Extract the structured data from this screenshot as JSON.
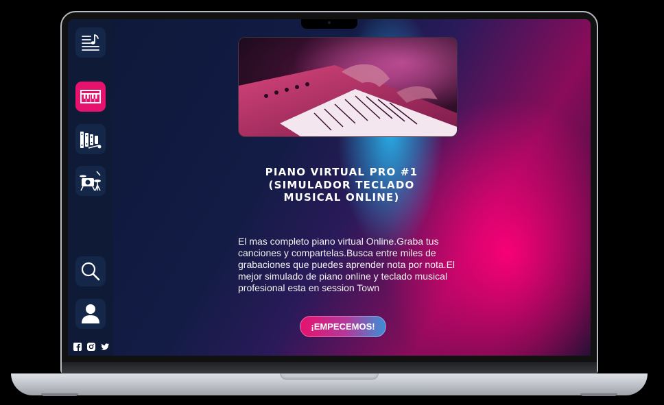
{
  "sidebar": {
    "items": [
      {
        "name": "sheet-music-icon"
      },
      {
        "name": "piano-icon",
        "active": true
      },
      {
        "name": "xylophone-icon"
      },
      {
        "name": "drums-icon"
      },
      {
        "name": "search-icon"
      },
      {
        "name": "user-icon"
      }
    ],
    "social": [
      "facebook-icon",
      "instagram-icon",
      "twitter-icon"
    ]
  },
  "hero": {
    "image": "keyboard-player-photo",
    "title": "PIANO VIRTUAL PRO #1 (SIMULADOR TECLADO MUSICAL ONLINE)",
    "description": "El mas completo piano virtual Online.Graba tus canciones y compartelas.Busca entre miles de grabaciones que puedes aprender nota por nota.El mejor simulado de piano online y teclado musical profesional esta en session Town",
    "cta_label": "¡EMPECEMOS!"
  },
  "colors": {
    "accent": "#e6126e",
    "sidebar": "#0e1a36",
    "button": "#142749",
    "cyan_glow": "#28c8ff"
  }
}
